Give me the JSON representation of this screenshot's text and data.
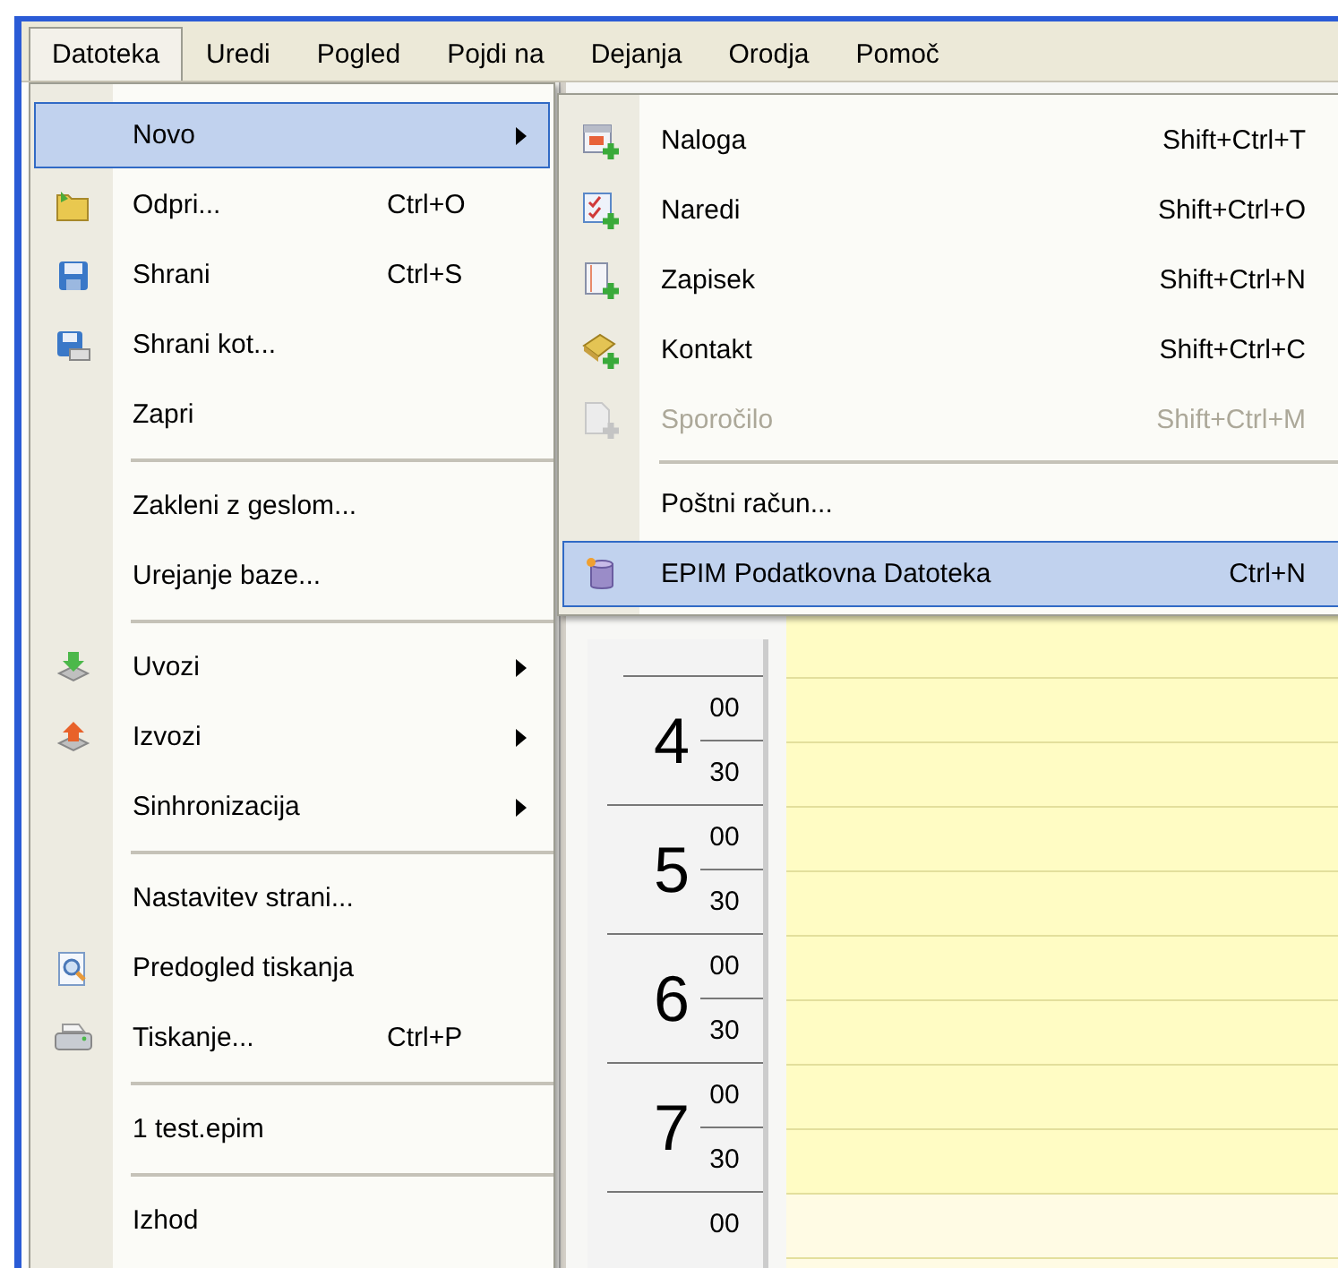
{
  "menu_bar": [
    {
      "label": "Datoteka",
      "selected": true
    },
    {
      "label": "Uredi",
      "selected": false
    },
    {
      "label": "Pogled",
      "selected": false
    },
    {
      "label": "Pojdi na",
      "selected": false
    },
    {
      "label": "Dejanja",
      "selected": false
    },
    {
      "label": "Orodja",
      "selected": false
    },
    {
      "label": "Pomoč",
      "selected": false
    }
  ],
  "file_menu": {
    "items": [
      {
        "kind": "item",
        "label": "Novo",
        "has_submenu": true,
        "selected": true
      },
      {
        "kind": "item",
        "label": "Odpri...",
        "shortcut": "Ctrl+O",
        "selected": false
      },
      {
        "kind": "item",
        "label": "Shrani",
        "shortcut": "Ctrl+S",
        "selected": false
      },
      {
        "kind": "item",
        "label": "Shrani kot...",
        "selected": false
      },
      {
        "kind": "item",
        "label": "Zapri",
        "selected": false
      },
      {
        "kind": "separator"
      },
      {
        "kind": "item",
        "label": "Zakleni z geslom...",
        "selected": false
      },
      {
        "kind": "item",
        "label": "Urejanje baze...",
        "selected": false
      },
      {
        "kind": "separator"
      },
      {
        "kind": "item",
        "label": "Uvozi",
        "has_submenu": true,
        "selected": false
      },
      {
        "kind": "item",
        "label": "Izvozi",
        "has_submenu": true,
        "selected": false
      },
      {
        "kind": "item",
        "label": "Sinhronizacija",
        "has_submenu": true,
        "selected": false
      },
      {
        "kind": "separator"
      },
      {
        "kind": "item",
        "label": "Nastavitev strani...",
        "selected": false
      },
      {
        "kind": "item",
        "label": "Predogled tiskanja",
        "selected": false
      },
      {
        "kind": "item",
        "label": "Tiskanje...",
        "shortcut": "Ctrl+P",
        "selected": false
      },
      {
        "kind": "separator"
      },
      {
        "kind": "item",
        "label": "1 test.epim",
        "selected": false
      },
      {
        "kind": "separator"
      },
      {
        "kind": "item",
        "label": "Izhod",
        "selected": false
      }
    ]
  },
  "new_submenu": {
    "items": [
      {
        "kind": "item",
        "label": "Naloga",
        "shortcut": "Shift+Ctrl+T",
        "disabled": false,
        "selected": false
      },
      {
        "kind": "item",
        "label": "Naredi",
        "shortcut": "Shift+Ctrl+O",
        "disabled": false,
        "selected": false
      },
      {
        "kind": "item",
        "label": "Zapisek",
        "shortcut": "Shift+Ctrl+N",
        "disabled": false,
        "selected": false
      },
      {
        "kind": "item",
        "label": "Kontakt",
        "shortcut": "Shift+Ctrl+C",
        "disabled": false,
        "selected": false
      },
      {
        "kind": "item",
        "label": "Sporočilo",
        "shortcut": "Shift+Ctrl+M",
        "disabled": true,
        "selected": false
      },
      {
        "kind": "separator"
      },
      {
        "kind": "item",
        "label": "Poštni račun...",
        "disabled": false,
        "selected": false
      },
      {
        "kind": "item",
        "label": "EPIM Podatkovna Datoteka",
        "shortcut": "Ctrl+N",
        "disabled": false,
        "selected": true
      }
    ]
  },
  "calendar": {
    "hours": [
      {
        "hour": "4",
        "minutes": [
          "00",
          "30"
        ]
      },
      {
        "hour": "5",
        "minutes": [
          "00",
          "30"
        ]
      },
      {
        "hour": "6",
        "minutes": [
          "00",
          "30"
        ]
      },
      {
        "hour": "7",
        "minutes": [
          "00",
          "30"
        ]
      },
      {
        "minutes": [
          "00"
        ]
      }
    ]
  }
}
